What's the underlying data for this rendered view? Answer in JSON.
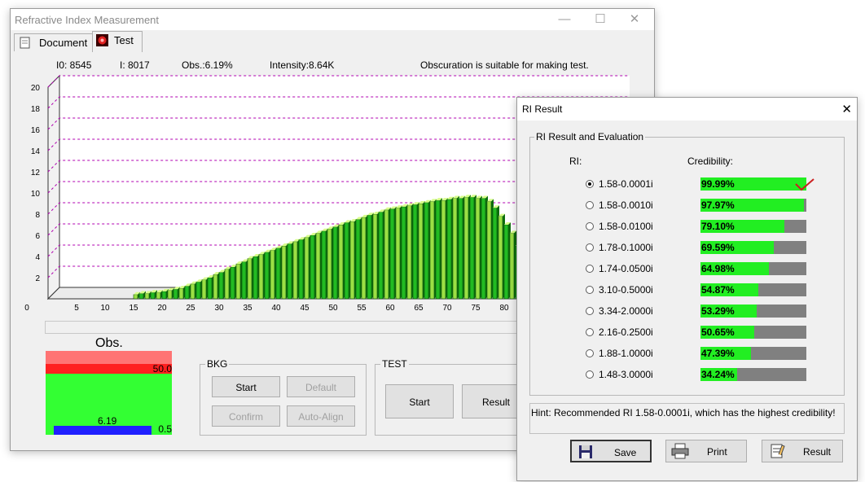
{
  "main_window": {
    "title": "Refractive Index Measurement",
    "tabs": [
      {
        "label": "Document"
      },
      {
        "label": "Test"
      }
    ],
    "status": {
      "i0": "I0:  8545",
      "i": "I:  8017",
      "obs": "Obs.:6.19%",
      "intensity": "Intensity:8.64K",
      "message": "Obscuration is suitable for making test."
    }
  },
  "chart_data": {
    "type": "bar",
    "x": [
      15,
      16,
      17,
      18,
      19,
      20,
      21,
      22,
      23,
      24,
      25,
      26,
      27,
      28,
      29,
      30,
      31,
      32,
      33,
      34,
      35,
      36,
      37,
      38,
      39,
      40,
      41,
      42,
      43,
      44,
      45,
      46,
      47,
      48,
      49,
      50,
      51,
      52,
      53,
      54,
      55,
      56,
      57,
      58,
      59,
      60,
      61,
      62,
      63,
      64,
      65,
      66,
      67,
      68,
      69,
      70,
      71,
      72,
      73,
      74,
      75,
      76,
      77,
      78,
      79,
      80,
      81,
      82
    ],
    "values": [
      0.4,
      0.5,
      0.5,
      0.6,
      0.6,
      0.7,
      0.8,
      0.9,
      1.0,
      1.2,
      1.4,
      1.6,
      1.8,
      2.0,
      2.3,
      2.5,
      2.8,
      3.0,
      3.3,
      3.5,
      3.8,
      4.0,
      4.2,
      4.4,
      4.6,
      4.8,
      5.0,
      5.2,
      5.4,
      5.6,
      5.8,
      6.0,
      6.2,
      6.4,
      6.6,
      6.8,
      7.0,
      7.2,
      7.3,
      7.5,
      7.7,
      7.9,
      8.0,
      8.2,
      8.4,
      8.5,
      8.6,
      8.7,
      8.8,
      8.9,
      9.0,
      9.1,
      9.2,
      9.3,
      9.3,
      9.4,
      9.5,
      9.5,
      9.6,
      9.6,
      9.5,
      9.5,
      9.2,
      8.6,
      7.8,
      7.0,
      6.2,
      5.0
    ],
    "x_ticks": [
      0,
      5,
      10,
      15,
      20,
      25,
      30,
      35,
      40,
      45,
      50,
      55,
      60,
      65,
      70,
      75,
      80
    ],
    "y_ticks": [
      2,
      4,
      6,
      8,
      10,
      12,
      14,
      16,
      18,
      20
    ],
    "ylim": [
      0,
      20
    ],
    "grid": true
  },
  "obs_panel": {
    "title": "Obs.",
    "upper": "50.0",
    "value": "6.19",
    "lower": "0.5"
  },
  "bkg": {
    "label": "BKG",
    "start": "Start",
    "default": "Default",
    "confirm": "Confirm",
    "auto_align": "Auto-Align"
  },
  "test": {
    "label": "TEST",
    "start": "Start",
    "result": "Result"
  },
  "ri_dialog": {
    "title": "RI Result",
    "group_label": "RI Result and Evaluation",
    "col_ri": "RI:",
    "col_cred": "Credibility:",
    "rows": [
      {
        "ri": "1.58-0.0001i",
        "cred": "99.99%",
        "fraction": 0.9999,
        "selected": true
      },
      {
        "ri": "1.58-0.0010i",
        "cred": "97.97%",
        "fraction": 0.9797,
        "selected": false
      },
      {
        "ri": "1.58-0.0100i",
        "cred": "79.10%",
        "fraction": 0.791,
        "selected": false
      },
      {
        "ri": "1.78-0.1000i",
        "cred": "69.59%",
        "fraction": 0.6959,
        "selected": false
      },
      {
        "ri": "1.74-0.0500i",
        "cred": "64.98%",
        "fraction": 0.6498,
        "selected": false
      },
      {
        "ri": "3.10-0.5000i",
        "cred": "54.87%",
        "fraction": 0.5487,
        "selected": false
      },
      {
        "ri": "3.34-2.0000i",
        "cred": "53.29%",
        "fraction": 0.5329,
        "selected": false
      },
      {
        "ri": "2.16-0.2500i",
        "cred": "50.65%",
        "fraction": 0.5065,
        "selected": false
      },
      {
        "ri": "1.88-1.0000i",
        "cred": "47.39%",
        "fraction": 0.4739,
        "selected": false
      },
      {
        "ri": "1.48-3.0000i",
        "cred": "34.24%",
        "fraction": 0.3424,
        "selected": false
      }
    ],
    "hint": "Hint: Recommended RI 1.58-0.0001i, which has the highest credibility!",
    "buttons": {
      "save": "Save",
      "print": "Print",
      "result": "Result"
    }
  }
}
